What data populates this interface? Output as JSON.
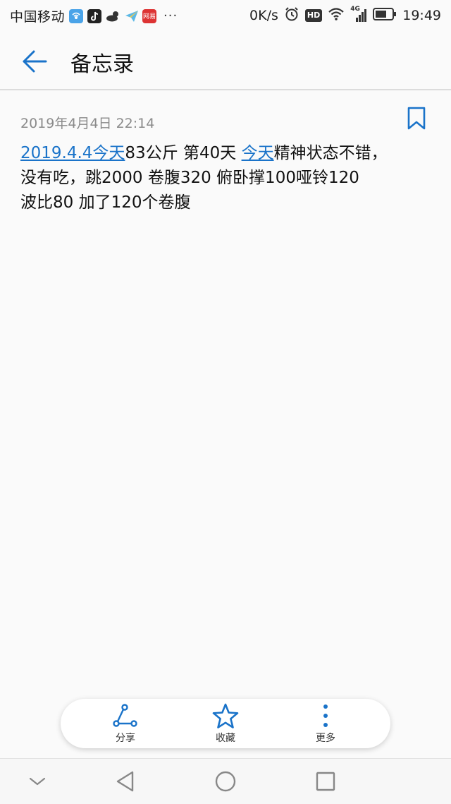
{
  "status_bar": {
    "carrier": "中国移动",
    "dots": "···",
    "network_speed": "0K/s",
    "hd": "HD",
    "network_type": "4G",
    "time": "19:49",
    "app_icons": [
      "wifi-hotspot-icon",
      "tiktok-icon",
      "weather-icon",
      "paper-plane-icon",
      "netease-news-icon"
    ],
    "app_icon_text": {
      "netease": "网易"
    },
    "battery_level": 0.7
  },
  "app_bar": {
    "title": "备忘录"
  },
  "note": {
    "timestamp": "2019年4月4日 22:14",
    "line1": {
      "link1": "2019.4.4今天",
      "text1": "83公斤  第40天 ",
      "link2": "今天",
      "text2": "精神状态不错，"
    },
    "line2": "没有吃，跳2000 卷腹320 俯卧撑100哑铃120",
    "line3": "波比80 加了120个卷腹"
  },
  "actions": {
    "share": "分享",
    "favorite": "收藏",
    "more": "更多"
  },
  "colors": {
    "accent": "#1a73c9",
    "background": "#fafafa",
    "meta_text": "#8a8a8a"
  }
}
